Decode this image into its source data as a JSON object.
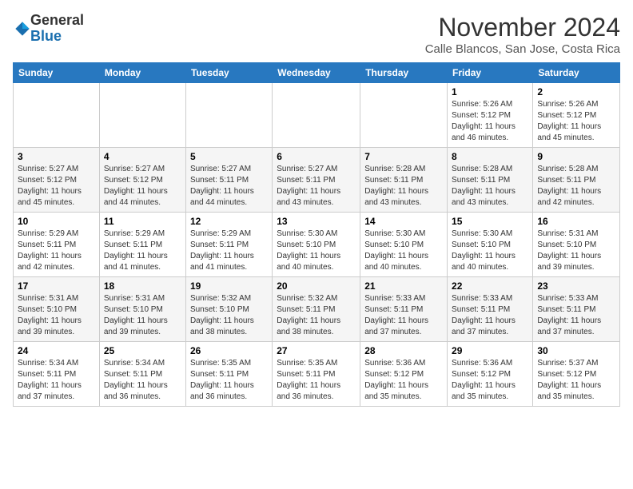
{
  "logo": {
    "general": "General",
    "blue": "Blue"
  },
  "header": {
    "month": "November 2024",
    "location": "Calle Blancos, San Jose, Costa Rica"
  },
  "weekdays": [
    "Sunday",
    "Monday",
    "Tuesday",
    "Wednesday",
    "Thursday",
    "Friday",
    "Saturday"
  ],
  "weeks": [
    [
      {
        "day": "",
        "info": ""
      },
      {
        "day": "",
        "info": ""
      },
      {
        "day": "",
        "info": ""
      },
      {
        "day": "",
        "info": ""
      },
      {
        "day": "",
        "info": ""
      },
      {
        "day": "1",
        "info": "Sunrise: 5:26 AM\nSunset: 5:12 PM\nDaylight: 11 hours and 46 minutes."
      },
      {
        "day": "2",
        "info": "Sunrise: 5:26 AM\nSunset: 5:12 PM\nDaylight: 11 hours and 45 minutes."
      }
    ],
    [
      {
        "day": "3",
        "info": "Sunrise: 5:27 AM\nSunset: 5:12 PM\nDaylight: 11 hours and 45 minutes."
      },
      {
        "day": "4",
        "info": "Sunrise: 5:27 AM\nSunset: 5:12 PM\nDaylight: 11 hours and 44 minutes."
      },
      {
        "day": "5",
        "info": "Sunrise: 5:27 AM\nSunset: 5:11 PM\nDaylight: 11 hours and 44 minutes."
      },
      {
        "day": "6",
        "info": "Sunrise: 5:27 AM\nSunset: 5:11 PM\nDaylight: 11 hours and 43 minutes."
      },
      {
        "day": "7",
        "info": "Sunrise: 5:28 AM\nSunset: 5:11 PM\nDaylight: 11 hours and 43 minutes."
      },
      {
        "day": "8",
        "info": "Sunrise: 5:28 AM\nSunset: 5:11 PM\nDaylight: 11 hours and 43 minutes."
      },
      {
        "day": "9",
        "info": "Sunrise: 5:28 AM\nSunset: 5:11 PM\nDaylight: 11 hours and 42 minutes."
      }
    ],
    [
      {
        "day": "10",
        "info": "Sunrise: 5:29 AM\nSunset: 5:11 PM\nDaylight: 11 hours and 42 minutes."
      },
      {
        "day": "11",
        "info": "Sunrise: 5:29 AM\nSunset: 5:11 PM\nDaylight: 11 hours and 41 minutes."
      },
      {
        "day": "12",
        "info": "Sunrise: 5:29 AM\nSunset: 5:11 PM\nDaylight: 11 hours and 41 minutes."
      },
      {
        "day": "13",
        "info": "Sunrise: 5:30 AM\nSunset: 5:10 PM\nDaylight: 11 hours and 40 minutes."
      },
      {
        "day": "14",
        "info": "Sunrise: 5:30 AM\nSunset: 5:10 PM\nDaylight: 11 hours and 40 minutes."
      },
      {
        "day": "15",
        "info": "Sunrise: 5:30 AM\nSunset: 5:10 PM\nDaylight: 11 hours and 40 minutes."
      },
      {
        "day": "16",
        "info": "Sunrise: 5:31 AM\nSunset: 5:10 PM\nDaylight: 11 hours and 39 minutes."
      }
    ],
    [
      {
        "day": "17",
        "info": "Sunrise: 5:31 AM\nSunset: 5:10 PM\nDaylight: 11 hours and 39 minutes."
      },
      {
        "day": "18",
        "info": "Sunrise: 5:31 AM\nSunset: 5:10 PM\nDaylight: 11 hours and 39 minutes."
      },
      {
        "day": "19",
        "info": "Sunrise: 5:32 AM\nSunset: 5:10 PM\nDaylight: 11 hours and 38 minutes."
      },
      {
        "day": "20",
        "info": "Sunrise: 5:32 AM\nSunset: 5:11 PM\nDaylight: 11 hours and 38 minutes."
      },
      {
        "day": "21",
        "info": "Sunrise: 5:33 AM\nSunset: 5:11 PM\nDaylight: 11 hours and 37 minutes."
      },
      {
        "day": "22",
        "info": "Sunrise: 5:33 AM\nSunset: 5:11 PM\nDaylight: 11 hours and 37 minutes."
      },
      {
        "day": "23",
        "info": "Sunrise: 5:33 AM\nSunset: 5:11 PM\nDaylight: 11 hours and 37 minutes."
      }
    ],
    [
      {
        "day": "24",
        "info": "Sunrise: 5:34 AM\nSunset: 5:11 PM\nDaylight: 11 hours and 37 minutes."
      },
      {
        "day": "25",
        "info": "Sunrise: 5:34 AM\nSunset: 5:11 PM\nDaylight: 11 hours and 36 minutes."
      },
      {
        "day": "26",
        "info": "Sunrise: 5:35 AM\nSunset: 5:11 PM\nDaylight: 11 hours and 36 minutes."
      },
      {
        "day": "27",
        "info": "Sunrise: 5:35 AM\nSunset: 5:11 PM\nDaylight: 11 hours and 36 minutes."
      },
      {
        "day": "28",
        "info": "Sunrise: 5:36 AM\nSunset: 5:12 PM\nDaylight: 11 hours and 35 minutes."
      },
      {
        "day": "29",
        "info": "Sunrise: 5:36 AM\nSunset: 5:12 PM\nDaylight: 11 hours and 35 minutes."
      },
      {
        "day": "30",
        "info": "Sunrise: 5:37 AM\nSunset: 5:12 PM\nDaylight: 11 hours and 35 minutes."
      }
    ]
  ]
}
